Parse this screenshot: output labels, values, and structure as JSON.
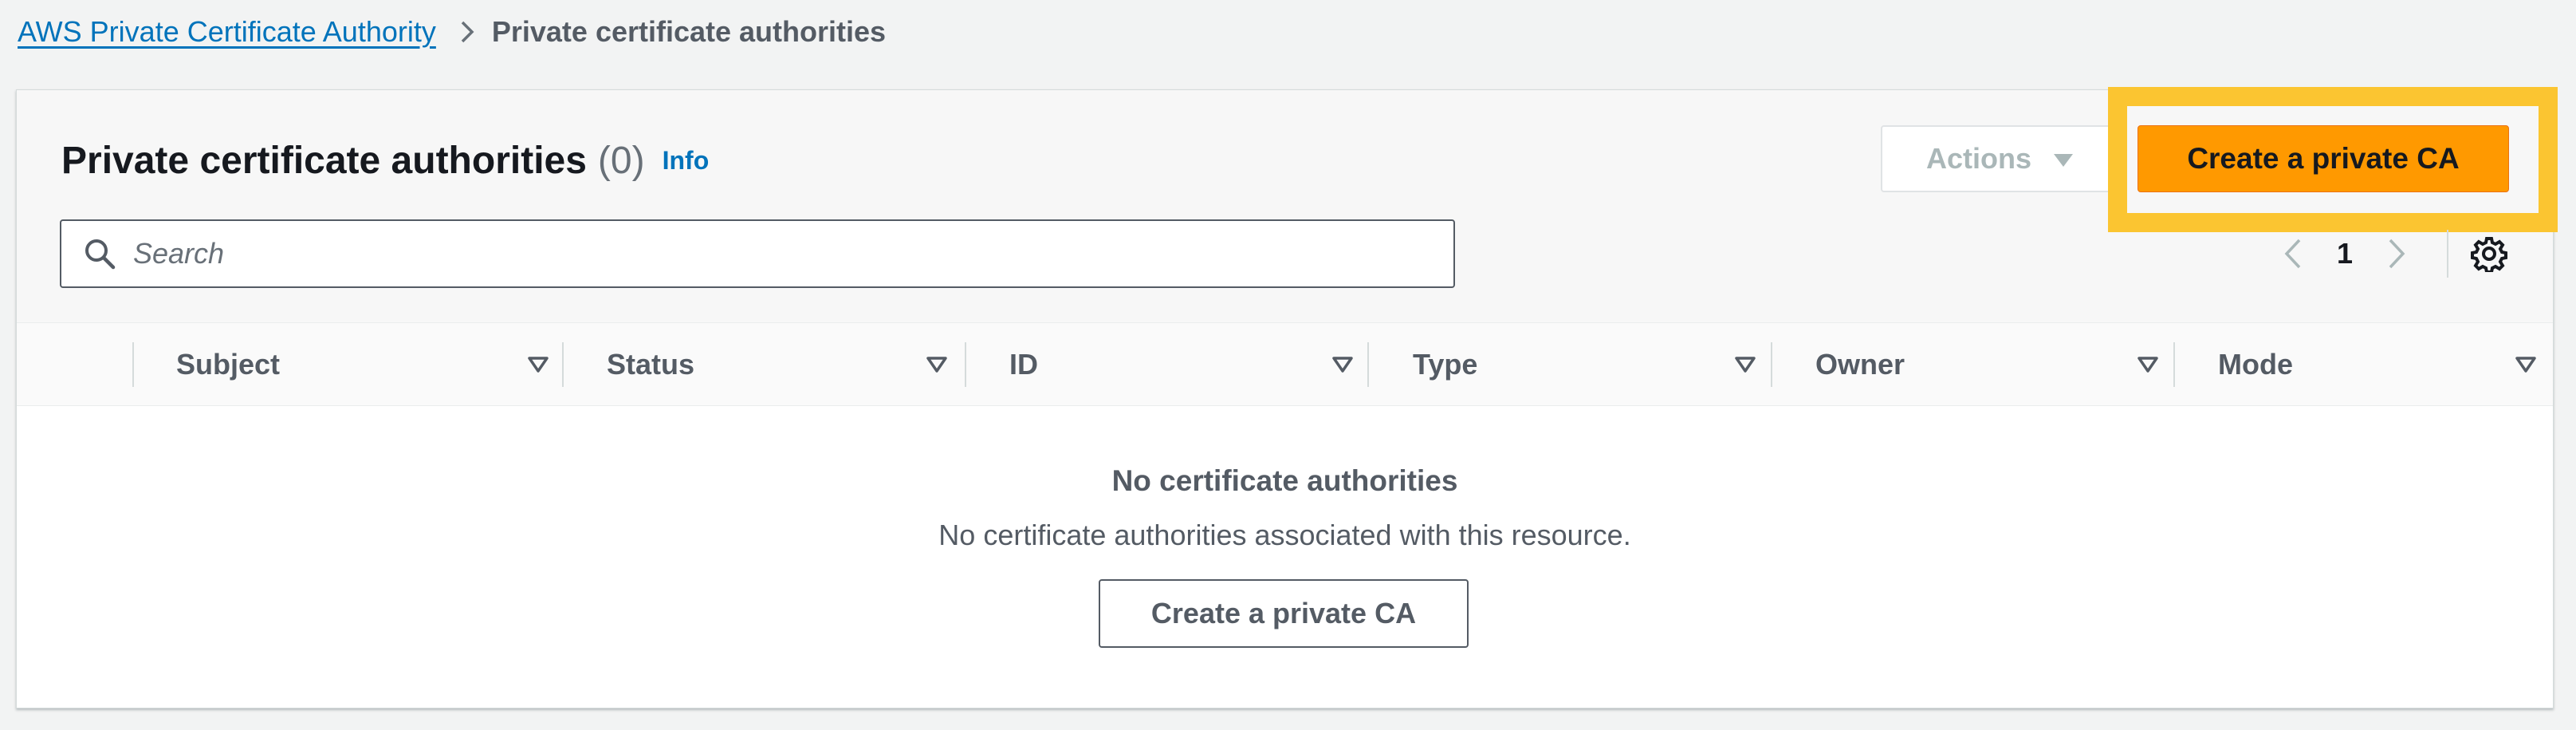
{
  "breadcrumb": {
    "root": "AWS Private Certificate Authority",
    "current": "Private certificate authorities"
  },
  "header": {
    "title": "Private certificate authorities",
    "count": "(0)",
    "info": "Info",
    "actions_label": "Actions",
    "create_label": "Create a private CA"
  },
  "search": {
    "placeholder": "Search",
    "value": ""
  },
  "pagination": {
    "current_page": "1"
  },
  "table": {
    "columns": [
      "Subject",
      "Status",
      "ID",
      "Type",
      "Owner",
      "Mode"
    ]
  },
  "empty_state": {
    "title": "No certificate authorities",
    "description": "No certificate authorities associated with this resource.",
    "button_label": "Create a private CA"
  },
  "colors": {
    "primary": "#ff9900",
    "link": "#0073bb",
    "highlight": "#fbc531"
  },
  "icons": [
    "chevron-right-icon",
    "caret-down-icon",
    "search-icon",
    "chevron-left-icon",
    "settings-gear-icon",
    "sort-caret-icon"
  ]
}
